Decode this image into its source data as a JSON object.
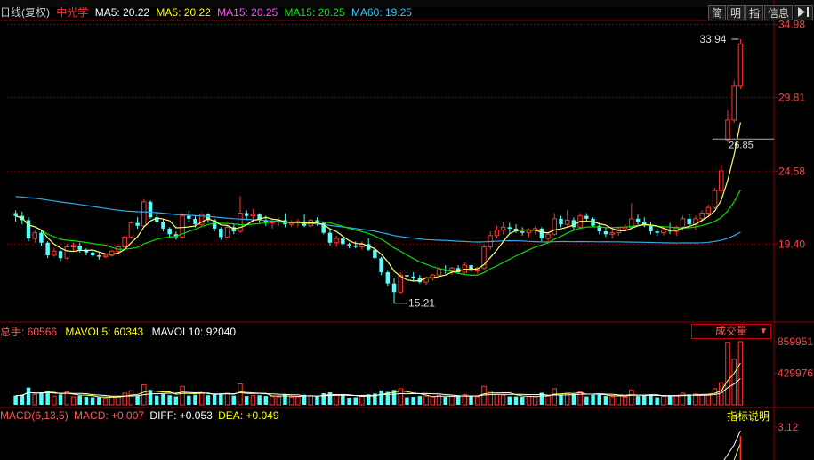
{
  "main_panel": {
    "period_label": "日线(复权)",
    "stock_name": "中光学",
    "ma": [
      {
        "label": "MA5: 20.22",
        "color": "#ffffff"
      },
      {
        "label": "MA5: 20.22",
        "color": "#ffff00"
      },
      {
        "label": "MA15: 20.25",
        "color": "#ff55ff"
      },
      {
        "label": "MA15: 20.25",
        "color": "#00ee00"
      },
      {
        "label": "MA60: 19.25",
        "color": "#33ccff"
      }
    ],
    "tabs": [
      "简",
      "明",
      "指",
      "信息"
    ],
    "price_axis_labels": [
      "34.98",
      "29.81",
      "24.58",
      "19.40"
    ],
    "high_marker": "33.94",
    "low_marker": "15.21",
    "last_marker": "26.85"
  },
  "volume_panel": {
    "header": [
      {
        "text": "总手: 60566",
        "color": "#ff5555"
      },
      {
        "text": "MAVOL5: 60343",
        "color": "#ffff00"
      },
      {
        "text": "MAVOL10: 92040",
        "color": "#ffffff"
      }
    ],
    "selector": "成交量",
    "axis_labels": [
      "859951",
      "429976"
    ]
  },
  "macd_panel": {
    "header": [
      {
        "text": "MACD(6,13,5)",
        "color": "#ff5555"
      },
      {
        "text": "MACD: +0.007",
        "color": "#ff5555"
      },
      {
        "text": "DIFF: +0.053",
        "color": "#ffffff"
      },
      {
        "text": "DEA: +0.049",
        "color": "#ffff00"
      }
    ],
    "help_button": "指标说明",
    "axis_label": "3.12"
  },
  "colors": {
    "up": "#ff3333",
    "down": "#54ffff",
    "grid": "#8b0000",
    "ma5": "#ffff66",
    "ma15": "#00dd00",
    "ma60": "#33aaee"
  },
  "chart_data": {
    "type": "candlestick",
    "price_range": [
      14.5,
      35.2
    ],
    "candles": [
      [
        21.6,
        21.8,
        21.0,
        21.4
      ],
      [
        21.4,
        21.7,
        20.8,
        21.1
      ],
      [
        21.1,
        21.3,
        19.6,
        19.8
      ],
      [
        19.8,
        20.4,
        19.5,
        20.2
      ],
      [
        20.2,
        20.4,
        19.3,
        19.5
      ],
      [
        19.5,
        19.6,
        18.4,
        18.6
      ],
      [
        18.6,
        19.1,
        18.5,
        18.9
      ],
      [
        18.9,
        19.0,
        18.2,
        18.4
      ],
      [
        18.4,
        19.4,
        18.3,
        19.2
      ],
      [
        19.2,
        19.5,
        18.9,
        19.3
      ],
      [
        19.3,
        19.5,
        18.8,
        19.0
      ],
      [
        19.0,
        19.1,
        18.6,
        18.8
      ],
      [
        18.8,
        18.9,
        18.5,
        18.6
      ],
      [
        18.6,
        18.8,
        18.3,
        18.5
      ],
      [
        18.5,
        18.7,
        18.4,
        18.6
      ],
      [
        18.6,
        19.0,
        18.5,
        18.9
      ],
      [
        18.9,
        19.3,
        18.8,
        19.2
      ],
      [
        19.2,
        20.0,
        19.1,
        19.9
      ],
      [
        19.9,
        21.0,
        19.8,
        20.9
      ],
      [
        20.9,
        21.3,
        20.5,
        20.7
      ],
      [
        20.7,
        22.6,
        20.6,
        22.4
      ],
      [
        22.4,
        22.5,
        21.2,
        21.3
      ],
      [
        21.3,
        21.6,
        20.9,
        21.0
      ],
      [
        21.0,
        21.2,
        20.3,
        20.5
      ],
      [
        20.5,
        20.6,
        19.9,
        20.1
      ],
      [
        20.1,
        20.3,
        19.7,
        19.9
      ],
      [
        19.9,
        21.6,
        19.8,
        21.4
      ],
      [
        21.4,
        21.8,
        21.0,
        21.2
      ],
      [
        21.2,
        21.4,
        20.6,
        20.8
      ],
      [
        20.8,
        21.6,
        20.7,
        21.5
      ],
      [
        21.5,
        21.6,
        20.9,
        21.1
      ],
      [
        21.1,
        21.2,
        20.3,
        20.5
      ],
      [
        20.5,
        20.6,
        19.7,
        19.9
      ],
      [
        19.9,
        20.7,
        19.8,
        20.6
      ],
      [
        20.6,
        20.8,
        20.1,
        20.3
      ],
      [
        20.3,
        22.8,
        20.2,
        21.6
      ],
      [
        21.6,
        21.8,
        21.1,
        21.4
      ],
      [
        21.4,
        21.9,
        21.0,
        21.5
      ],
      [
        21.5,
        21.6,
        20.9,
        21.1
      ],
      [
        21.1,
        21.4,
        20.7,
        20.9
      ],
      [
        20.9,
        21.2,
        20.5,
        21.0
      ],
      [
        21.0,
        21.3,
        20.7,
        21.1
      ],
      [
        21.1,
        21.6,
        20.6,
        20.8
      ],
      [
        20.8,
        21.1,
        20.6,
        20.9
      ],
      [
        20.9,
        21.2,
        20.6,
        21.0
      ],
      [
        21.0,
        21.5,
        20.6,
        20.7
      ],
      [
        20.7,
        21.2,
        20.6,
        21.1
      ],
      [
        21.1,
        21.3,
        20.7,
        20.9
      ],
      [
        20.9,
        21.0,
        20.1,
        20.2
      ],
      [
        20.2,
        20.4,
        19.3,
        19.5
      ],
      [
        19.5,
        20.0,
        19.2,
        19.8
      ],
      [
        19.8,
        19.9,
        19.2,
        19.4
      ],
      [
        19.4,
        19.5,
        19.1,
        19.3
      ],
      [
        19.3,
        19.6,
        19.1,
        19.2
      ],
      [
        19.2,
        19.6,
        19.0,
        19.4
      ],
      [
        19.4,
        19.8,
        18.9,
        19.0
      ],
      [
        19.0,
        19.2,
        18.3,
        18.4
      ],
      [
        18.4,
        18.5,
        17.2,
        17.4
      ],
      [
        17.4,
        17.5,
        16.4,
        16.6
      ],
      [
        16.6,
        17.0,
        15.2,
        16.0
      ],
      [
        16.0,
        17.4,
        15.9,
        17.2
      ],
      [
        17.2,
        17.4,
        16.9,
        17.1
      ],
      [
        17.1,
        17.4,
        16.8,
        17.0
      ],
      [
        17.0,
        17.2,
        16.6,
        16.7
      ],
      [
        16.7,
        17.1,
        16.5,
        17.0
      ],
      [
        17.0,
        17.3,
        16.8,
        17.2
      ],
      [
        17.2,
        17.8,
        17.1,
        17.6
      ],
      [
        17.6,
        17.9,
        17.3,
        17.5
      ],
      [
        17.5,
        17.8,
        17.2,
        17.7
      ],
      [
        17.7,
        17.9,
        17.3,
        17.4
      ],
      [
        17.4,
        18.1,
        17.3,
        17.9
      ],
      [
        17.9,
        18.0,
        17.4,
        17.5
      ],
      [
        17.5,
        17.8,
        17.3,
        17.7
      ],
      [
        17.7,
        19.4,
        17.6,
        19.2
      ],
      [
        19.2,
        20.3,
        19.0,
        20.0
      ],
      [
        20.0,
        20.7,
        19.8,
        20.4
      ],
      [
        20.4,
        21.0,
        20.1,
        20.6
      ],
      [
        20.6,
        20.9,
        20.2,
        20.5
      ],
      [
        20.5,
        20.8,
        20.2,
        20.3
      ],
      [
        20.3,
        20.6,
        20.0,
        20.2
      ],
      [
        20.2,
        20.5,
        19.9,
        20.4
      ],
      [
        20.4,
        20.7,
        20.1,
        20.5
      ],
      [
        20.5,
        20.6,
        19.6,
        19.8
      ],
      [
        19.8,
        20.2,
        19.6,
        20.1
      ],
      [
        20.1,
        21.6,
        20.0,
        21.2
      ],
      [
        21.2,
        21.4,
        20.6,
        20.8
      ],
      [
        20.8,
        21.8,
        20.6,
        21.1
      ],
      [
        21.1,
        21.3,
        20.4,
        20.6
      ],
      [
        20.6,
        21.6,
        20.5,
        21.4
      ],
      [
        21.4,
        21.6,
        21.0,
        21.2
      ],
      [
        21.2,
        21.3,
        20.6,
        20.7
      ],
      [
        20.7,
        20.9,
        20.1,
        20.3
      ],
      [
        20.3,
        20.6,
        19.9,
        20.1
      ],
      [
        20.1,
        20.4,
        19.8,
        20.2
      ],
      [
        20.2,
        20.6,
        20.0,
        20.5
      ],
      [
        20.5,
        20.8,
        20.3,
        20.6
      ],
      [
        20.6,
        22.3,
        20.5,
        21.2
      ],
      [
        21.2,
        21.5,
        20.8,
        21.0
      ],
      [
        21.0,
        21.3,
        20.6,
        20.7
      ],
      [
        20.7,
        21.0,
        20.1,
        20.3
      ],
      [
        20.3,
        20.5,
        20.0,
        20.2
      ],
      [
        20.2,
        20.6,
        20.0,
        20.4
      ],
      [
        20.4,
        20.9,
        20.1,
        20.3
      ],
      [
        20.3,
        20.7,
        20.0,
        20.6
      ],
      [
        20.6,
        21.4,
        20.4,
        21.2
      ],
      [
        21.2,
        21.5,
        20.7,
        20.8
      ],
      [
        20.8,
        21.4,
        20.4,
        21.2
      ],
      [
        21.2,
        21.8,
        21.0,
        21.6
      ],
      [
        21.6,
        22.2,
        21.3,
        22.0
      ],
      [
        22.0,
        23.4,
        21.9,
        23.2
      ],
      [
        23.2,
        25.0,
        23.0,
        24.6
      ],
      [
        26.8,
        28.9,
        26.6,
        28.2
      ],
      [
        28.2,
        31.0,
        28.0,
        30.6
      ],
      [
        30.6,
        33.94,
        30.4,
        33.6
      ]
    ],
    "volume_range": [
      0,
      859951
    ]
  }
}
